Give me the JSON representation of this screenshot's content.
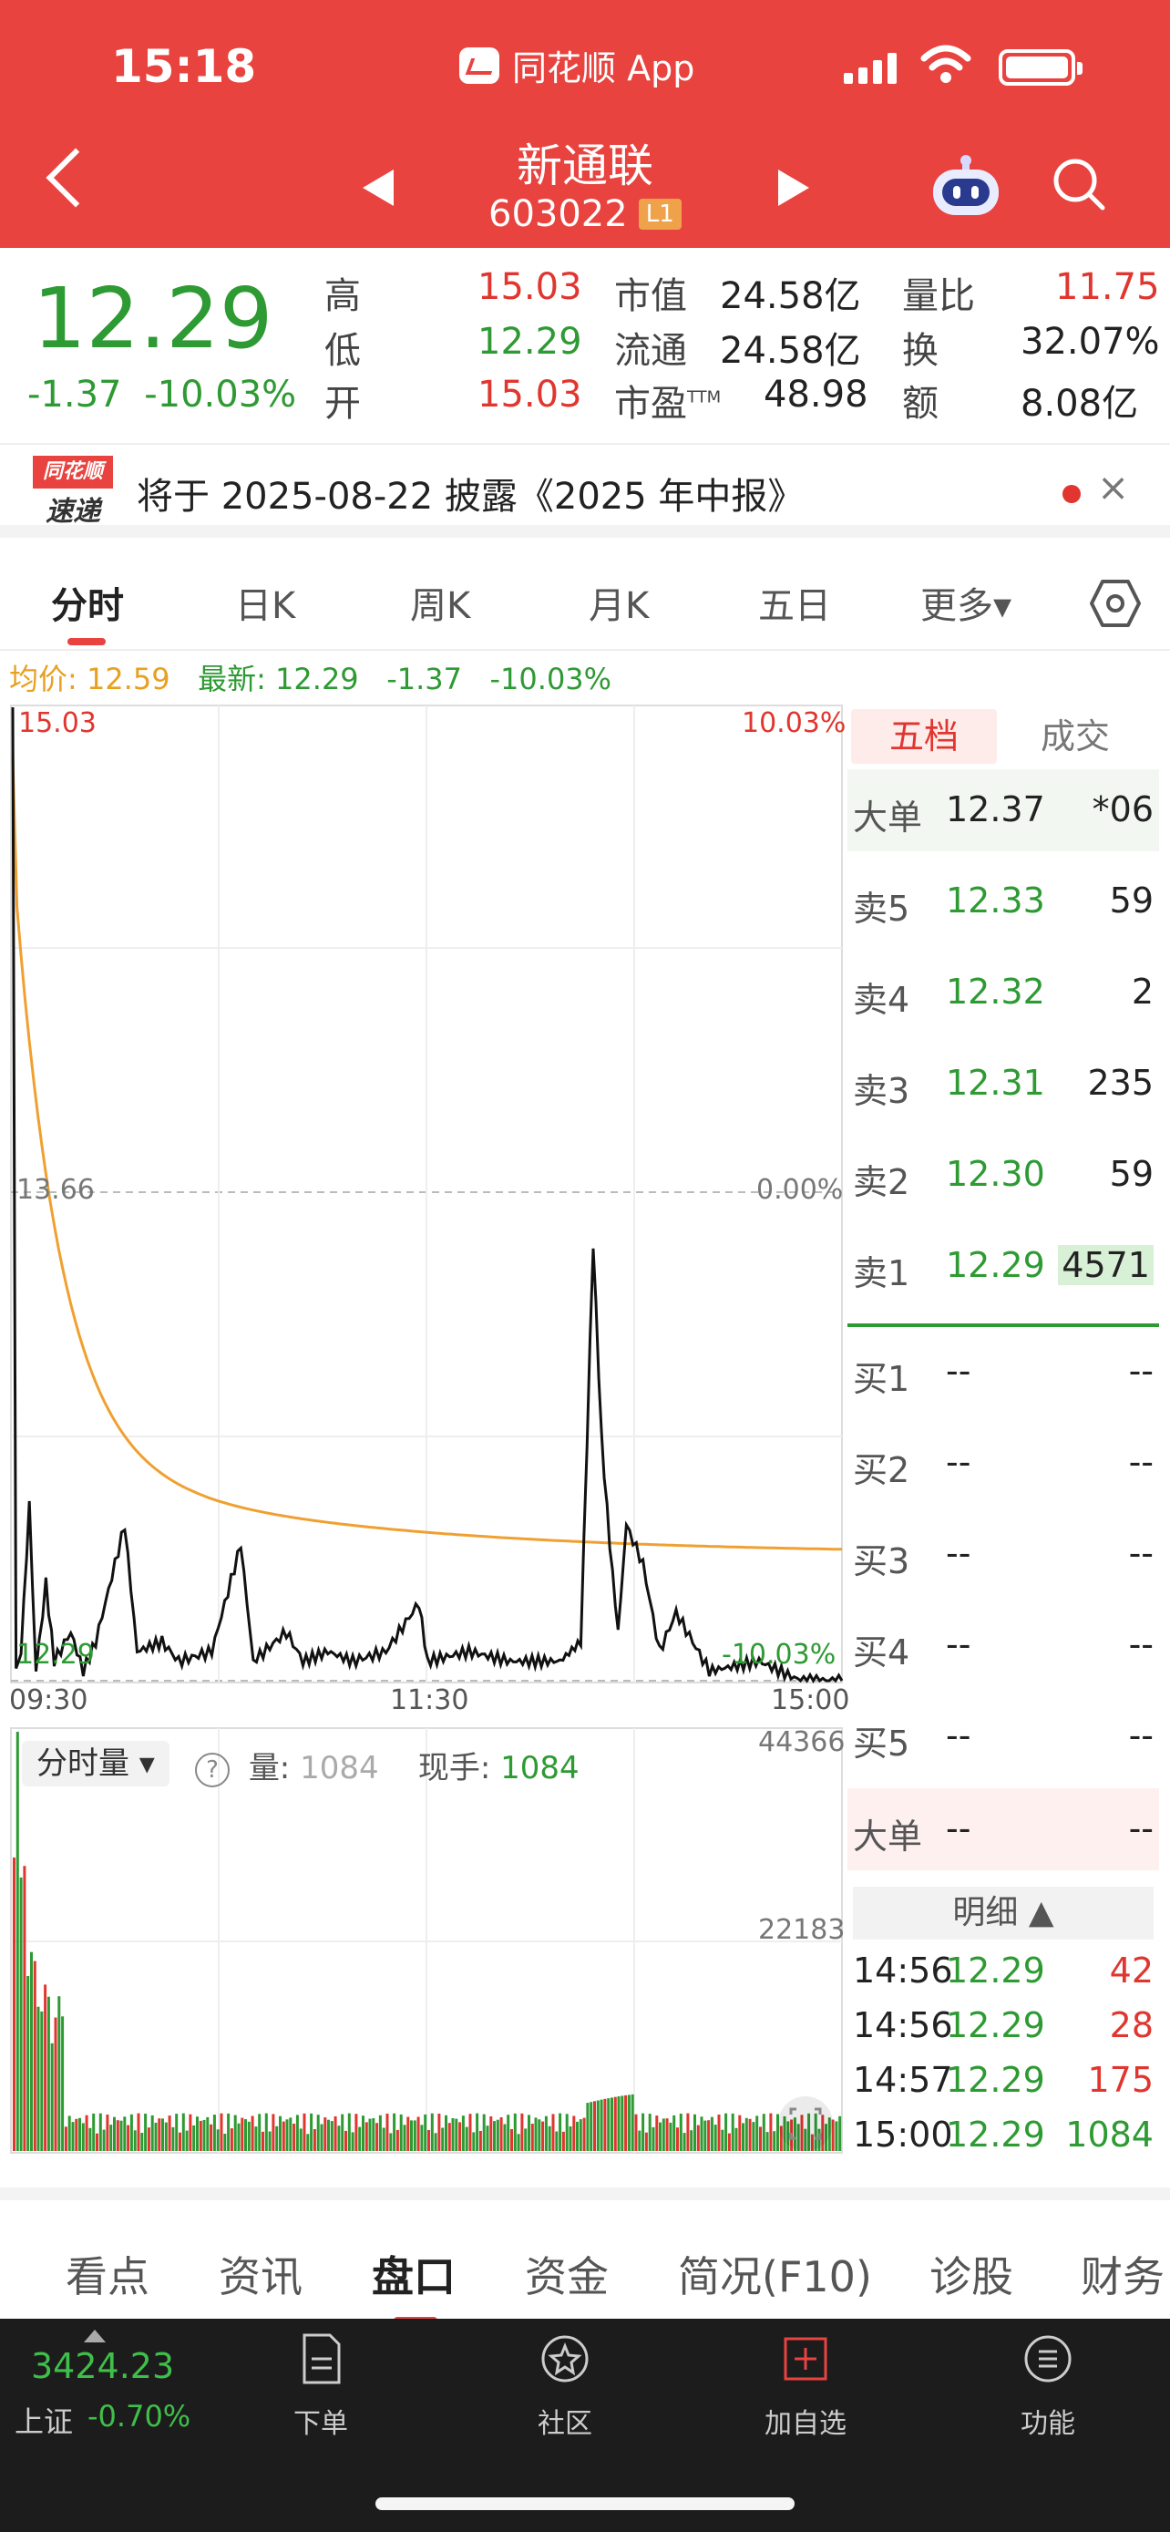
{
  "status": {
    "time": "15:18",
    "app_label": "同花顺 App"
  },
  "stock": {
    "name": "新通联",
    "code": "603022",
    "level_badge": "L1"
  },
  "quote": {
    "price": "12.29",
    "change": "-1.37",
    "change_pct": "-10.03%",
    "high_label": "高",
    "high": "15.03",
    "low_label": "低",
    "low": "12.29",
    "open_label": "开",
    "open": "15.03",
    "mktcap_label": "市值",
    "mktcap": "24.58亿",
    "float_label": "流通",
    "float": "24.58亿",
    "pe_label": "市盈",
    "pe_sup": "TTM",
    "pe": "48.98",
    "volratio_label": "量比",
    "volratio": "11.75",
    "turnover_label": "换",
    "turnover": "32.07%",
    "amount_label": "额",
    "amount": "8.08亿"
  },
  "notice": {
    "logo_top": "同花顺",
    "logo_bottom": "速递",
    "text": "将于 2025-08-22 披露《2025 年中报》",
    "close": "×"
  },
  "tabs": [
    "分时",
    "日K",
    "周K",
    "月K",
    "五日",
    "更多▾"
  ],
  "avg_line": {
    "avg_label": "均价: 12.59",
    "latest_label": "最新: 12.29",
    "chg": "-1.37",
    "pct": "-10.03%"
  },
  "chart": {
    "price_top": "15.03",
    "price_mid": "13.66",
    "price_bottom": "12.29",
    "pct_top": "10.03%",
    "pct_mid": "0.00%",
    "pct_bottom": "-10.03%",
    "time_start": "09:30",
    "time_mid": "11:30",
    "time_end": "15:00",
    "vol_top": "44366",
    "vol_mid": "22183",
    "colors": {
      "price_line": "#111111",
      "avg_line": "#f0a030",
      "up": "#e0362f",
      "down": "#2e9a33"
    }
  },
  "volume_panel": {
    "selector": "分时量 ▾",
    "help": "?",
    "vol_label": "量:",
    "vol_value": "1084",
    "hand_label": "现手:",
    "hand_value": "1084"
  },
  "orderbook": {
    "tabs": [
      "五档",
      "成交"
    ],
    "big_top": {
      "k": "大单",
      "p": "12.37",
      "v": "*06"
    },
    "asks": [
      {
        "k": "卖5",
        "p": "12.33",
        "v": "59"
      },
      {
        "k": "卖4",
        "p": "12.32",
        "v": "2"
      },
      {
        "k": "卖3",
        "p": "12.31",
        "v": "235"
      },
      {
        "k": "卖2",
        "p": "12.30",
        "v": "59"
      },
      {
        "k": "卖1",
        "p": "12.29",
        "v": "4571"
      }
    ],
    "bids": [
      {
        "k": "买1",
        "p": "--",
        "v": "--"
      },
      {
        "k": "买2",
        "p": "--",
        "v": "--"
      },
      {
        "k": "买3",
        "p": "--",
        "v": "--"
      },
      {
        "k": "买4",
        "p": "--",
        "v": "--"
      },
      {
        "k": "买5",
        "p": "--",
        "v": "--"
      }
    ],
    "big_bottom": {
      "k": "大单",
      "p": "--",
      "v": "--"
    },
    "detail_label": "明细 ▲",
    "trades": [
      {
        "t": "14:56",
        "p": "12.29",
        "v": "42"
      },
      {
        "t": "14:56",
        "p": "12.29",
        "v": "28"
      },
      {
        "t": "14:57",
        "p": "12.29",
        "v": "175"
      },
      {
        "t": "15:00",
        "p": "12.29",
        "v": "1084"
      }
    ]
  },
  "subtabs": [
    "看点",
    "资讯",
    "盘口",
    "资金",
    "简况(F10)",
    "诊股",
    "财务"
  ],
  "bottom_bar": {
    "index_value": "3424.23",
    "index_name": "上证",
    "index_chg": "-0.70%",
    "items": [
      "下单",
      "社区",
      "加自选",
      "功能"
    ]
  }
}
